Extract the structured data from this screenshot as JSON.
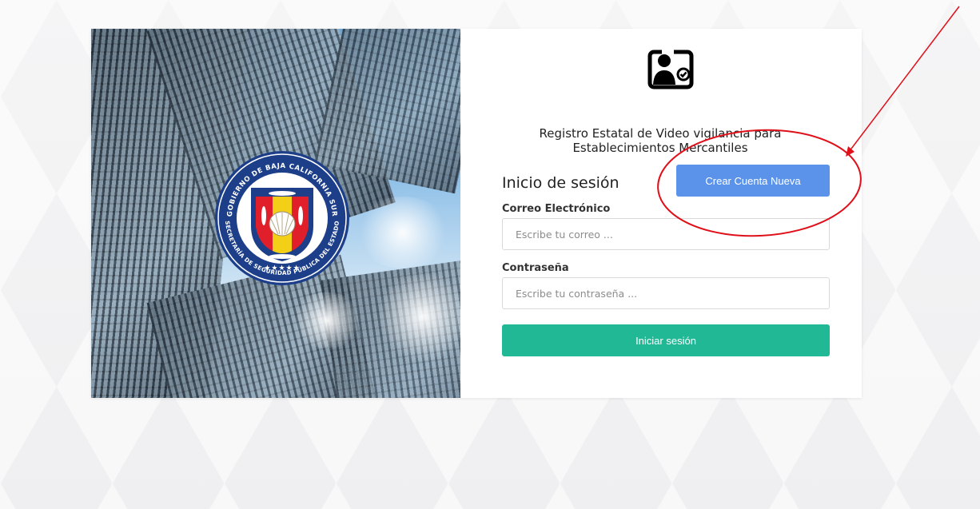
{
  "header": {
    "system_title": "Registro Estatal de Video vigilancia para Establecimientos Mercantiles"
  },
  "login": {
    "title": "Inicio de sesión",
    "create_account_label": "Crear Cuenta Nueva",
    "email": {
      "label": "Correo Electrónico",
      "placeholder": "Escribe tu correo ...",
      "value": ""
    },
    "password": {
      "label": "Contraseña",
      "placeholder": "Escribe tu contraseña ...",
      "value": ""
    },
    "submit_label": "Iniciar sesión"
  },
  "seal": {
    "outer_text": "GOBIERNO DE BAJA CALIFORNIA SUR",
    "inner_text": "SECRETARÍA DE SEGURIDAD PÚBLICA DEL ESTADO",
    "stars": "★★★★★"
  },
  "icons": {
    "user_card": "user-id-card-icon"
  },
  "colors": {
    "create_button": "#5b93ea",
    "submit_button": "#21b995",
    "annotation": "#e0101a"
  }
}
